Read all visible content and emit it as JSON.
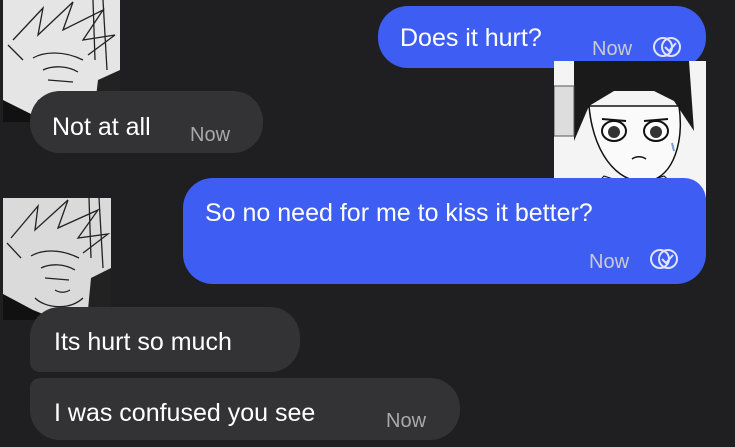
{
  "messages": [
    {
      "text": "Does it hurt?",
      "time": "Now",
      "direction": "sent",
      "status_icon": "double-check-circle-icon"
    },
    {
      "text": "Not at all",
      "time": "Now",
      "direction": "received"
    },
    {
      "text": "So no need for me to kiss it better?",
      "time": "Now",
      "direction": "sent",
      "status_icon": "double-check-circle-icon"
    },
    {
      "text": "Its hurt so much",
      "direction": "received"
    },
    {
      "text": "I was confused you see",
      "time": "Now",
      "direction": "received"
    }
  ],
  "avatars": [
    {
      "name": "white-haired-character-avatar",
      "style": "manga-drawing"
    },
    {
      "name": "dark-haired-character-avatar",
      "style": "manga-drawing"
    },
    {
      "name": "white-haired-character-avatar",
      "style": "manga-drawing"
    }
  ],
  "colors": {
    "background": "#1f1f22",
    "sent_bubble": "#3e5ef3",
    "received_bubble": "#333336",
    "text": "#ffffff"
  }
}
